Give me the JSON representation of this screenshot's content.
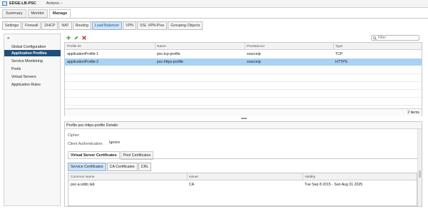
{
  "window": {
    "title": "EDGE-LB-PSC",
    "actions_label": "Actions –"
  },
  "top_tabs": [
    {
      "label": "Summary",
      "active": false
    },
    {
      "label": "Monitor",
      "active": false
    },
    {
      "label": "Manage",
      "active": true
    }
  ],
  "sub_tabs": [
    {
      "label": "Settings",
      "active": false
    },
    {
      "label": "Firewall",
      "active": false
    },
    {
      "label": "DHCP",
      "active": false
    },
    {
      "label": "NAT",
      "active": false
    },
    {
      "label": "Routing",
      "active": false
    },
    {
      "label": "Load Balancer",
      "active": true
    },
    {
      "label": "VPN",
      "active": false
    },
    {
      "label": "SSL VPN-Plus",
      "active": false
    },
    {
      "label": "Grouping Objects",
      "active": false
    }
  ],
  "sidebar": {
    "collapse_glyph": "«",
    "items": [
      {
        "label": "Global Configuration",
        "active": false
      },
      {
        "label": "Application Profiles",
        "active": true
      },
      {
        "label": "Service Monitoring",
        "active": false
      },
      {
        "label": "Pools",
        "active": false
      },
      {
        "label": "Virtual Servers",
        "active": false
      },
      {
        "label": "Application Rules",
        "active": false
      }
    ]
  },
  "toolbar": {
    "add_icon": "add-icon",
    "edit_icon": "edit-icon",
    "delete_icon": "delete-icon",
    "filter_placeholder": "Filter"
  },
  "profiles_table": {
    "columns": [
      "Profile ID",
      "Name",
      "Persistence",
      "Type"
    ],
    "rows": [
      {
        "id": "applicationProfile-1",
        "name": "psc-tcp-profile",
        "persistence": "sourceip",
        "type": "TCP",
        "selected": false
      },
      {
        "id": "applicationProfile-2",
        "name": "psc-https-profile",
        "persistence": "sourceip",
        "type": "HTTPS",
        "selected": true
      }
    ],
    "footer": "2 items"
  },
  "details": {
    "title": "Profile psc-https-profile Details:",
    "cipher_label": "Cipher:",
    "cipher_value": "",
    "client_auth_label": "Client Authentication:",
    "client_auth_value": "Ignore",
    "cert_tabs": [
      {
        "label": "Virtual Server Certificates",
        "active": true
      },
      {
        "label": "Pool Certificates",
        "active": false
      }
    ],
    "cert_subtabs": [
      {
        "label": "Service Certificates",
        "active": true
      },
      {
        "label": "CA Certificates",
        "active": false
      },
      {
        "label": "CRL",
        "active": false
      }
    ],
    "cert_table": {
      "columns": [
        "Common Name",
        "Issuer",
        "Validity"
      ],
      "rows": [
        {
          "common_name": "psc-a.sddc.lab",
          "issuer": "CA",
          "validity": "Tue Sep 8 2015 - Sun Aug 31 2025"
        }
      ]
    }
  },
  "colors": {
    "accent": "#1f4e79",
    "selection": "#a9d2f5",
    "active_tab": "#cfe3f7"
  }
}
